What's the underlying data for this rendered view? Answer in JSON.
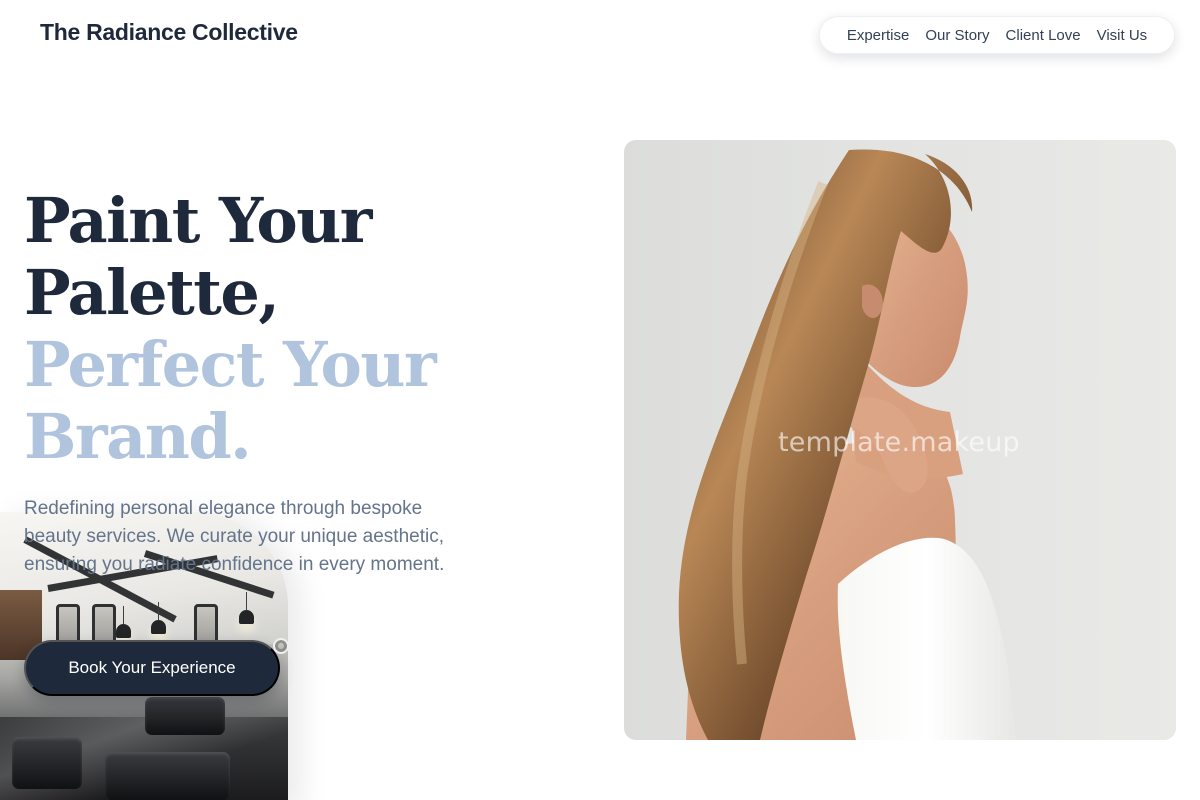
{
  "brand": {
    "name": "The Radiance Collective"
  },
  "navigation": {
    "items": [
      {
        "label": "Expertise"
      },
      {
        "label": "Our Story"
      },
      {
        "label": "Client Love"
      },
      {
        "label": "Visit Us"
      }
    ]
  },
  "hero": {
    "headline_line_1": "Paint Your",
    "headline_line_2": "Palette,",
    "headline_line_3": "Perfect Your",
    "headline_line_4": "Brand.",
    "description": "Redefining personal elegance through bespoke beauty services. We curate your unique aesthetic, ensuring you radiate confidence in every moment.",
    "cta_label": "Book Your Experience"
  },
  "images": {
    "watermark": "template.makeup"
  },
  "colors": {
    "primary_dark": "#1e293b",
    "accent_blue": "#b0c4de",
    "body_text": "#64748b",
    "background": "#ffffff"
  }
}
